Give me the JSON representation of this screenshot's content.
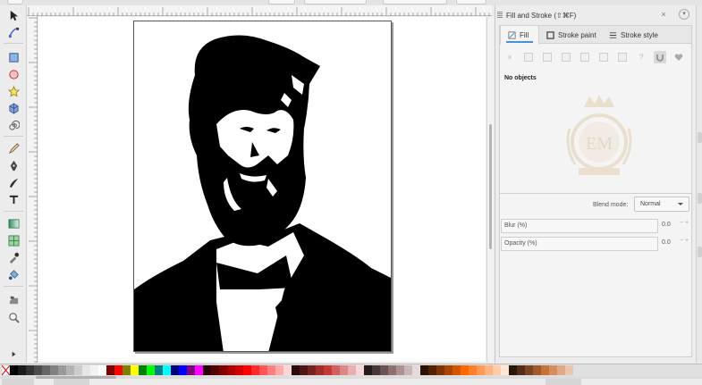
{
  "dock": {
    "title": "Fill and Stroke (⇧⌘F)",
    "close_glyph": "×"
  },
  "tabs": [
    {
      "label": "Fill"
    },
    {
      "label": "Stroke paint"
    },
    {
      "label": "Stroke style"
    }
  ],
  "fill_modes": [
    {
      "icon": "no-paint-icon",
      "glyph": "×"
    },
    {
      "icon": "flat-color-icon"
    },
    {
      "icon": "linear-gradient-icon"
    },
    {
      "icon": "radial-gradient-icon"
    },
    {
      "icon": "mesh-gradient-icon"
    },
    {
      "icon": "pattern-icon"
    },
    {
      "icon": "swatch-icon"
    },
    {
      "icon": "unset-paint-icon",
      "glyph": "?"
    },
    {
      "icon": "evenodd-fill-icon"
    },
    {
      "icon": "nonzero-fill-icon"
    }
  ],
  "status_text": "No objects",
  "blend": {
    "label": "Blend mode:",
    "value": "Normal"
  },
  "blur": {
    "label": "Blur (%)",
    "value": "0.0",
    "spin": "− +"
  },
  "opacity": {
    "label": "Opacity (%)",
    "value": "0.0",
    "spin": "− +"
  },
  "watermark_text": "EM",
  "palette": {
    "none_icon": "none-swatch-icon",
    "colors": [
      "#000000",
      "#1a1a1a",
      "#333333",
      "#4d4d4d",
      "#666666",
      "#808080",
      "#999999",
      "#b3b3b3",
      "#cccccc",
      "#e6e6e6",
      "#f2f2f2",
      "#ffffff",
      "#800000",
      "#ff0000",
      "#808000",
      "#ffff00",
      "#008000",
      "#00ff00",
      "#008080",
      "#00ffff",
      "#000080",
      "#0000ff",
      "#800080",
      "#ff00ff",
      "#2b0000",
      "#550000",
      "#800000",
      "#aa0000",
      "#d40000",
      "#ff0000",
      "#ff2a2a",
      "#ff5555",
      "#ff8080",
      "#ffaaaa",
      "#ffd5d5",
      "#280b0b",
      "#501616",
      "#782121",
      "#a02c2c",
      "#c83737",
      "#d35f5f",
      "#de8787",
      "#e9afaf",
      "#f4d7d7",
      "#241c1c",
      "#483737",
      "#6c5353",
      "#916f6f",
      "#ac9393",
      "#c8b7b7",
      "#e3dbdb",
      "#2b1100",
      "#552200",
      "#803300",
      "#aa4400",
      "#d45500",
      "#ff6600",
      "#ff7f2a",
      "#ff9955",
      "#ffb380",
      "#ffccaa",
      "#ffe6d5",
      "#28170b",
      "#502d16",
      "#784421",
      "#a05a2c",
      "#c87137",
      "#d38d5f",
      "#deaa87",
      "#e9c6af"
    ]
  }
}
